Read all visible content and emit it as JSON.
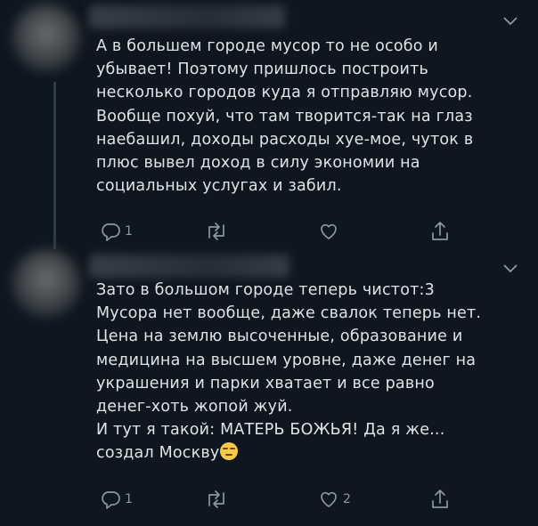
{
  "tweets": [
    {
      "text": "А в большем городе мусор то не особо и\nубывает! Поэтому пришлось построить\nнесколько городов куда я отправляю мусор.\nВообще похуй, что там творится-так на глаз\nнаебашил, доходы расходы хуе-мое, чуток в\nплюс вывел доход в силу экономии на\nсоциальных услугах и забил.",
      "reply_count": "1",
      "retweet_count": "",
      "like_count": ""
    },
    {
      "text": "Зато в большом городе теперь чистот:3\nМусора нет вообще, даже свалок теперь нет.\nЦена на землю высоченные, образование и\nмедицина на высшем уровне, даже денег на\nукрашения и парки хватает и все равно\nденег-хоть жопой жуй.\nИ тут я такой: МАТЕРЬ БОЖЬЯ! Да я же...\nсоздал Москву",
      "emoji": "expressionless-face-emoji",
      "reply_count": "1",
      "retweet_count": "",
      "like_count": "2"
    }
  ],
  "icons": {
    "reply": "reply-icon",
    "retweet": "retweet-icon",
    "like": "like-icon",
    "share": "share-icon",
    "menu": "chevron-down-icon"
  },
  "colors": {
    "background": "#0e1620",
    "text": "#dfe3e8",
    "icon": "#8b98a5",
    "thread_line": "#2f3b48"
  }
}
